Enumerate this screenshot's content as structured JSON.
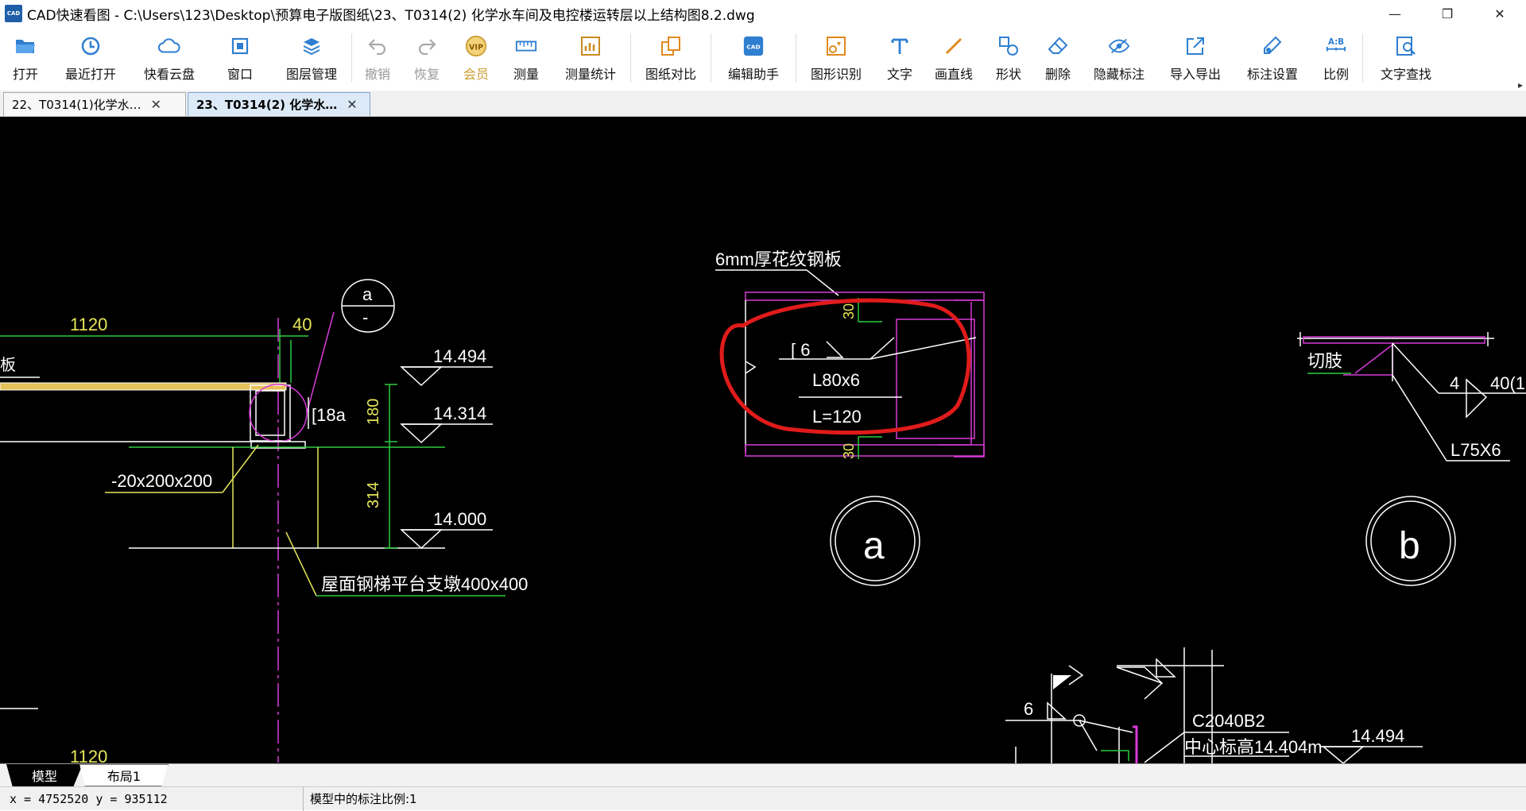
{
  "window": {
    "logo": "CAD",
    "title": "CAD快速看图 - C:\\Users\\123\\Desktop\\预算电子版图纸\\23、T0314(2) 化学水车间及电控楼运转层以上结构图8.2.dwg",
    "minimize": "—",
    "maximize": "❐",
    "close": "✕"
  },
  "toolbar": {
    "open": "打开",
    "recent": "最近打开",
    "cloud": "快看云盘",
    "window": "窗口",
    "layers": "图层管理",
    "undo": "撤销",
    "redo": "恢复",
    "vip": "会员",
    "vip_badge": "VIP",
    "measure": "测量",
    "measure_stats": "测量统计",
    "compare": "图纸对比",
    "edit_helper": "编辑助手",
    "shape_recognize": "图形识别",
    "text": "文字",
    "draw_line": "画直线",
    "shape": "形状",
    "delete": "删除",
    "hide_annotation": "隐藏标注",
    "import_export": "导入导出",
    "annotation_settings": "标注设置",
    "scale": "比例",
    "text_search": "文字查找",
    "more": "▸"
  },
  "tabs": [
    {
      "label": "22、T0314(1)化学水…",
      "close": "✕"
    },
    {
      "label": "23、T0314(2) 化学水…",
      "close": "✕"
    }
  ],
  "drawing": {
    "dim_1120": "1120",
    "dim_40": "40",
    "dim_180": "180",
    "dim_314": "314",
    "elev_14494": "14.494",
    "elev_14314": "14.314",
    "elev_14000": "14.000",
    "plate": "-20x200x200",
    "channel": "[18a",
    "bubble_a_top": "a",
    "bubble_a_bottom": "-",
    "cut_left": "板",
    "pier_note": "屋面钢梯平台支墩400x400",
    "bottom_1120": "1120",
    "checker_plate": "6mm厚花纹钢板",
    "dim_30_top": "30",
    "dim_30_bottom": "30",
    "weld_6": "[ 6",
    "angle_L80": "L80x6",
    "length_L": "L=120",
    "detail_a": "a",
    "detail_b": "b",
    "cut_limb": "切肢",
    "weld_4": "4",
    "weld_40": "40(1",
    "angle_L75": "L75X6",
    "weld_6b": "6",
    "purlin": "C2040B2",
    "center_elev": "中心标高14.404m",
    "elev_14494b": "14.494"
  },
  "layout_tabs": {
    "model": "模型",
    "layout1": "布局1"
  },
  "status": {
    "coords": "x = 4752520  y = 935112",
    "scale_text": "模型中的标注比例:1"
  }
}
